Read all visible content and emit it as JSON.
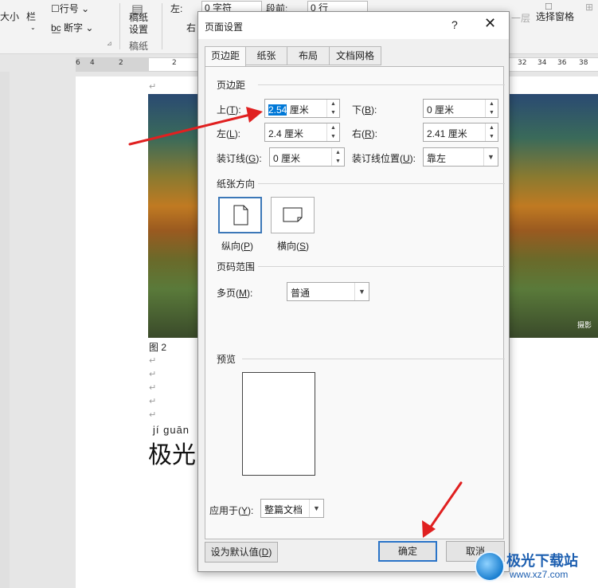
{
  "ribbon": {
    "left_partial": "大小",
    "lan_label": "栏",
    "line_number": "行号",
    "hyphenation": "断字",
    "draft_paper_top": "稿纸",
    "draft_paper_bottom": "设置",
    "draft_group": "稿纸",
    "indent_left_label": "左:",
    "indent_left_value": "0 字符",
    "indent_right_label": "右",
    "spacing_before_label": "段前:",
    "spacing_before_value": "0 行",
    "selection_pane": "选择窗格",
    "layer_partial": "一层"
  },
  "ruler": {
    "ticks": [
      "6",
      "4",
      "2",
      "2",
      "32",
      "34",
      "36",
      "38"
    ]
  },
  "document": {
    "figure_caption": "图 2",
    "paragraph_mark": "↵",
    "pinyin": "jí guān",
    "heading_partial": "极光",
    "photo_credit": "摄影"
  },
  "dialog": {
    "title": "页面设置",
    "help": "?",
    "close": "✕",
    "tabs": [
      "页边距",
      "纸张",
      "布局",
      "文档网格"
    ],
    "margins_section": "页边距",
    "top_label": "上(T):",
    "top_value_selected": "2.54",
    "top_value_rest": " 厘米",
    "bottom_label": "下(B):",
    "bottom_value": "0 厘米",
    "left_label": "左(L):",
    "left_value": "2.4 厘米",
    "right_label": "右(R):",
    "right_value": "2.41 厘米",
    "gutter_label": "装订线(G):",
    "gutter_value": "0 厘米",
    "gutter_pos_label": "装订线位置(U):",
    "gutter_pos_value": "靠左",
    "orientation_section": "纸张方向",
    "portrait": "纵向(P)",
    "landscape": "横向(S)",
    "pages_section": "页码范围",
    "multi_pages_label": "多页(M):",
    "multi_pages_value": "普通",
    "preview_section": "预览",
    "apply_to_label": "应用于(Y):",
    "apply_to_value": "整篇文档",
    "set_default": "设为默认值(D)",
    "ok": "确定",
    "cancel": "取消"
  },
  "watermark": {
    "title": "极光下载站",
    "url": "www.xz7.com"
  },
  "colors": {
    "accent": "#2a74c8",
    "arrow": "#e02020",
    "selection": "#0078d7"
  }
}
